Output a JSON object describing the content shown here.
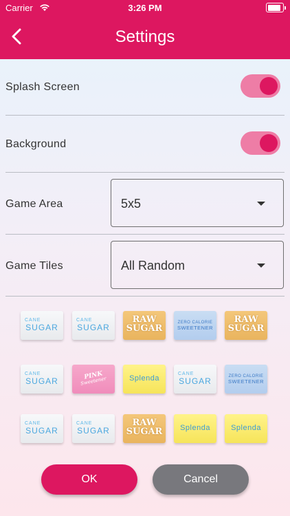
{
  "status_bar": {
    "carrier": "Carrier",
    "time": "3:26 PM"
  },
  "header": {
    "title": "Settings"
  },
  "settings": {
    "splash": {
      "label": "Splash Screen",
      "on": true
    },
    "background": {
      "label": "Background",
      "on": true
    },
    "game_area": {
      "label": "Game Area",
      "value": "5x5"
    },
    "game_tiles": {
      "label": "Game Tiles",
      "value": "All Random"
    }
  },
  "tiles": [
    {
      "kind": "cane",
      "t1": "CANE",
      "t2": "SUGAR"
    },
    {
      "kind": "cane",
      "t1": "CANE",
      "t2": "SUGAR"
    },
    {
      "kind": "raw",
      "t1": "RAW",
      "t2": "SUGAR"
    },
    {
      "kind": "zero",
      "t1": "ZERO CALORIE",
      "t2": "SWEETENER"
    },
    {
      "kind": "raw",
      "t1": "RAW",
      "t2": "SUGAR"
    },
    {
      "kind": "cane",
      "t1": "CANE",
      "t2": "SUGAR"
    },
    {
      "kind": "pink",
      "t1": "PINK",
      "t2": "Sweetener"
    },
    {
      "kind": "splenda",
      "t1": "Splenda",
      "t2": ""
    },
    {
      "kind": "cane",
      "t1": "CANE",
      "t2": "SUGAR"
    },
    {
      "kind": "zero",
      "t1": "ZERO CALORIE",
      "t2": "SWEETENER"
    },
    {
      "kind": "cane",
      "t1": "CANE",
      "t2": "SUGAR"
    },
    {
      "kind": "cane",
      "t1": "CANE",
      "t2": "SUGAR"
    },
    {
      "kind": "raw",
      "t1": "RAW",
      "t2": "SUGAR"
    },
    {
      "kind": "splenda",
      "t1": "Splenda",
      "t2": ""
    },
    {
      "kind": "splenda",
      "t1": "Splenda",
      "t2": ""
    }
  ],
  "buttons": {
    "ok": "OK",
    "cancel": "Cancel"
  },
  "colors": {
    "accent": "#dd1760",
    "toggle_track": "#ee7da6",
    "cancel": "#78787d"
  }
}
